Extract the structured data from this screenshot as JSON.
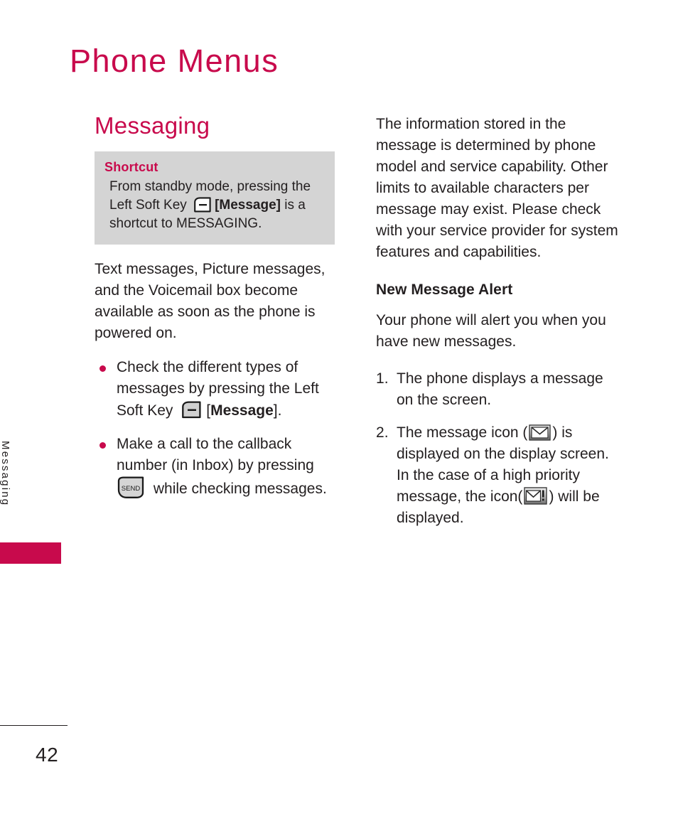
{
  "page": {
    "title": "Phone Menus",
    "number": "42",
    "side_tab_label": "Messaging",
    "accent_color": "#c80a4c",
    "text_color": "#231f20",
    "shortcut_box_color": "#d4d4d4"
  },
  "left_column": {
    "section_title": "Messaging",
    "shortcut": {
      "heading": "Shortcut",
      "text_part1": "From standby mode, pressing the Left Soft Key",
      "icon": "left-soft-key-icon",
      "text_part2": "[Message]",
      "text_part3": "is a shortcut to MESSAGING."
    },
    "intro_paragraph": "Text messages, Picture messages, and the Voicemail box become available as soon as the phone is powered on.",
    "bullets": [
      {
        "text_part1": "Check the different types of messages by pressing the Left Soft Key",
        "icon": "left-soft-key-icon",
        "text_part2": "[",
        "text_bold": "Message",
        "text_part3": "]."
      },
      {
        "text_part1": "Make a call to the callback number (in Inbox) by pressing",
        "icon": "send-key-icon",
        "icon_label": "SEND",
        "text_part2": "while checking messages."
      }
    ]
  },
  "right_column": {
    "paragraph": "The information stored in the message is determined by phone model and service capability. Other limits to available characters per message may exist. Please check with your service provider for system features and capabilities.",
    "sub_heading": "New Message Alert",
    "alert_paragraph": "Your phone will alert you when you have new messages.",
    "steps": [
      {
        "text": "The phone displays a message on the screen."
      },
      {
        "text_part1": "The message icon (",
        "icon": "envelope-icon",
        "text_part2": ") is displayed on the display screen. In the case of a high priority message, the icon(",
        "icon2": "envelope-priority-icon",
        "text_part3": ") will be displayed."
      }
    ]
  }
}
